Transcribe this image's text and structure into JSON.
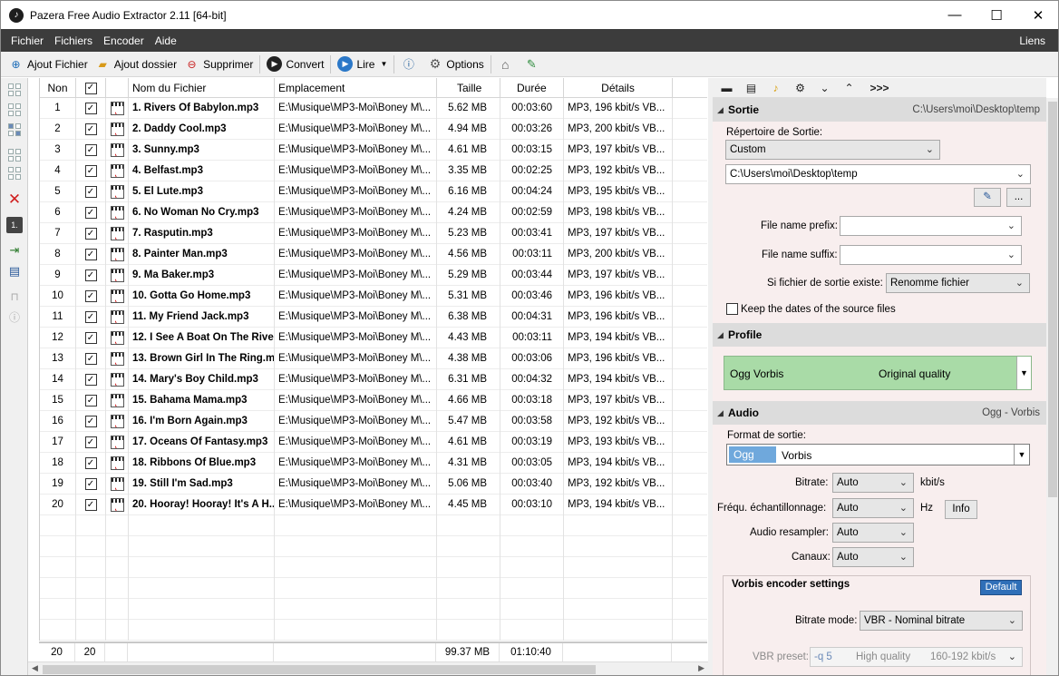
{
  "window": {
    "title": "Pazera Free Audio Extractor 2.11  [64-bit]",
    "app_icon": "music-note-icon"
  },
  "menu": {
    "items": [
      "Fichier",
      "Fichiers",
      "Encoder",
      "Aide"
    ],
    "right": "Liens"
  },
  "toolbar": {
    "add_file": "Ajout Fichier",
    "add_folder": "Ajout dossier",
    "delete": "Supprimer",
    "convert": "Convert",
    "play": "Lire",
    "options": "Options"
  },
  "table": {
    "headers": {
      "no": "Non",
      "name": "Nom du Fichier",
      "location": "Emplacement",
      "size": "Taille",
      "duration": "Durée",
      "details": "Détails"
    },
    "rows": [
      {
        "no": "1",
        "name": "1. Rivers Of Babylon.mp3",
        "loc": "E:\\Musique\\MP3-Moi\\Boney M\\...",
        "size": "5.62 MB",
        "dur": "00:03:60",
        "fmt": "MP3, 196 kbit/s VB..."
      },
      {
        "no": "2",
        "name": "2. Daddy Cool.mp3",
        "loc": "E:\\Musique\\MP3-Moi\\Boney M\\...",
        "size": "4.94 MB",
        "dur": "00:03:26",
        "fmt": "MP3, 200 kbit/s VB..."
      },
      {
        "no": "3",
        "name": "3. Sunny.mp3",
        "loc": "E:\\Musique\\MP3-Moi\\Boney M\\...",
        "size": "4.61 MB",
        "dur": "00:03:15",
        "fmt": "MP3, 197 kbit/s VB..."
      },
      {
        "no": "4",
        "name": "4. Belfast.mp3",
        "loc": "E:\\Musique\\MP3-Moi\\Boney M\\...",
        "size": "3.35 MB",
        "dur": "00:02:25",
        "fmt": "MP3, 192 kbit/s VB..."
      },
      {
        "no": "5",
        "name": "5. El Lute.mp3",
        "loc": "E:\\Musique\\MP3-Moi\\Boney M\\...",
        "size": "6.16 MB",
        "dur": "00:04:24",
        "fmt": "MP3, 195 kbit/s VB..."
      },
      {
        "no": "6",
        "name": "6. No Woman No Cry.mp3",
        "loc": "E:\\Musique\\MP3-Moi\\Boney M\\...",
        "size": "4.24 MB",
        "dur": "00:02:59",
        "fmt": "MP3, 198 kbit/s VB..."
      },
      {
        "no": "7",
        "name": "7. Rasputin.mp3",
        "loc": "E:\\Musique\\MP3-Moi\\Boney M\\...",
        "size": "5.23 MB",
        "dur": "00:03:41",
        "fmt": "MP3, 197 kbit/s VB..."
      },
      {
        "no": "8",
        "name": "8. Painter Man.mp3",
        "loc": "E:\\Musique\\MP3-Moi\\Boney M\\...",
        "size": "4.56 MB",
        "dur": "00:03:11",
        "fmt": "MP3, 200 kbit/s VB..."
      },
      {
        "no": "9",
        "name": "9. Ma Baker.mp3",
        "loc": "E:\\Musique\\MP3-Moi\\Boney M\\...",
        "size": "5.29 MB",
        "dur": "00:03:44",
        "fmt": "MP3, 197 kbit/s VB..."
      },
      {
        "no": "10",
        "name": "10. Gotta Go Home.mp3",
        "loc": "E:\\Musique\\MP3-Moi\\Boney M\\...",
        "size": "5.31 MB",
        "dur": "00:03:46",
        "fmt": "MP3, 196 kbit/s VB..."
      },
      {
        "no": "11",
        "name": "11. My Friend Jack.mp3",
        "loc": "E:\\Musique\\MP3-Moi\\Boney M\\...",
        "size": "6.38 MB",
        "dur": "00:04:31",
        "fmt": "MP3, 196 kbit/s VB..."
      },
      {
        "no": "12",
        "name": "12. I See A Boat On The Rive...",
        "loc": "E:\\Musique\\MP3-Moi\\Boney M\\...",
        "size": "4.43 MB",
        "dur": "00:03:11",
        "fmt": "MP3, 194 kbit/s VB..."
      },
      {
        "no": "13",
        "name": "13. Brown Girl In The Ring.m...",
        "loc": "E:\\Musique\\MP3-Moi\\Boney M\\...",
        "size": "4.38 MB",
        "dur": "00:03:06",
        "fmt": "MP3, 196 kbit/s VB..."
      },
      {
        "no": "14",
        "name": "14. Mary's Boy Child.mp3",
        "loc": "E:\\Musique\\MP3-Moi\\Boney M\\...",
        "size": "6.31 MB",
        "dur": "00:04:32",
        "fmt": "MP3, 194 kbit/s VB..."
      },
      {
        "no": "15",
        "name": "15. Bahama Mama.mp3",
        "loc": "E:\\Musique\\MP3-Moi\\Boney M\\...",
        "size": "4.66 MB",
        "dur": "00:03:18",
        "fmt": "MP3, 197 kbit/s VB..."
      },
      {
        "no": "16",
        "name": "16. I'm Born Again.mp3",
        "loc": "E:\\Musique\\MP3-Moi\\Boney M\\...",
        "size": "5.47 MB",
        "dur": "00:03:58",
        "fmt": "MP3, 192 kbit/s VB..."
      },
      {
        "no": "17",
        "name": "17. Oceans Of Fantasy.mp3",
        "loc": "E:\\Musique\\MP3-Moi\\Boney M\\...",
        "size": "4.61 MB",
        "dur": "00:03:19",
        "fmt": "MP3, 193 kbit/s VB..."
      },
      {
        "no": "18",
        "name": "18. Ribbons Of Blue.mp3",
        "loc": "E:\\Musique\\MP3-Moi\\Boney M\\...",
        "size": "4.31 MB",
        "dur": "00:03:05",
        "fmt": "MP3, 194 kbit/s VB..."
      },
      {
        "no": "19",
        "name": "19. Still I'm Sad.mp3",
        "loc": "E:\\Musique\\MP3-Moi\\Boney M\\...",
        "size": "5.06 MB",
        "dur": "00:03:40",
        "fmt": "MP3, 192 kbit/s VB..."
      },
      {
        "no": "20",
        "name": "20. Hooray! Hooray! It's A H...",
        "loc": "E:\\Musique\\MP3-Moi\\Boney M\\...",
        "size": "4.45 MB",
        "dur": "00:03:10",
        "fmt": "MP3, 194 kbit/s VB..."
      }
    ],
    "footer": {
      "count": "20",
      "checked": "20",
      "total_size": "99.37 MB",
      "total_duration": "01:10:40"
    }
  },
  "right_toolbar": {
    "more": ">>>"
  },
  "output": {
    "title": "Sortie",
    "path_display": "C:\\Users\\moi\\Desktop\\temp",
    "dir_label": "Répertoire de Sortie:",
    "dir_mode": "Custom",
    "dir_path": "C:\\Users\\moi\\Desktop\\temp",
    "browse_btn": "...",
    "prefix_label": "File name prefix:",
    "suffix_label": "File name suffix:",
    "exists_label": "Si fichier de sortie existe:",
    "exists_value": "Renomme fichier",
    "keep_dates_label": "Keep the dates of the source files"
  },
  "profile": {
    "title": "Profile",
    "name": "Ogg Vorbis",
    "quality": "Original quality"
  },
  "audio": {
    "title": "Audio",
    "right": "Ogg - Vorbis",
    "format_label": "Format de sortie:",
    "format_short": "Ogg",
    "format_long": "Vorbis",
    "bitrate_label": "Bitrate:",
    "bitrate_value": "Auto",
    "bitrate_unit": "kbit/s",
    "samplerate_label": "Fréqu. échantillonnage:",
    "samplerate_value": "Auto",
    "samplerate_unit": "Hz",
    "info_btn": "Info",
    "resampler_label": "Audio resampler:",
    "resampler_value": "Auto",
    "channels_label": "Canaux:",
    "channels_value": "Auto"
  },
  "vorbis": {
    "title": "Vorbis encoder settings",
    "default_btn": "Default",
    "mode_label": "Bitrate mode:",
    "mode_value": "VBR - Nominal bitrate",
    "preset_label": "VBR preset:",
    "preset_q": "-q  5",
    "preset_name": "High quality",
    "preset_range": "160-192 kbit/s"
  },
  "colors": {
    "menubar": "#3c3c3c",
    "profile_green": "#a9dba7",
    "format_blue": "#6fa8dc",
    "default_btn": "#2f6fb8",
    "panel_bg": "#f8eeee"
  }
}
